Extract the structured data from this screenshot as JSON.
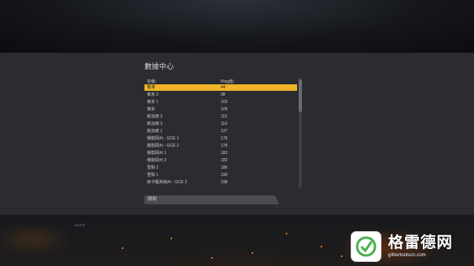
{
  "dialog": {
    "title": "數據中心",
    "columns": {
      "name": "名稱：",
      "ping": "Ping值："
    },
    "close_label": "關閉"
  },
  "servers": [
    {
      "name": "香港",
      "ping": "44",
      "selected": true
    },
    {
      "name": "東京 2",
      "ping": "98"
    },
    {
      "name": "東京 1",
      "ping": "103"
    },
    {
      "name": "東京",
      "ping": "109"
    },
    {
      "name": "新加坡 2",
      "ping": "115"
    },
    {
      "name": "新加坡 3",
      "ping": "116"
    },
    {
      "name": "新加坡 1",
      "ping": "127"
    },
    {
      "name": "俄勒岡州 - GCE 1",
      "ping": "178"
    },
    {
      "name": "俄勒岡州 - GCE 2",
      "ping": "178"
    },
    {
      "name": "俄勒岡州 1",
      "ping": "182"
    },
    {
      "name": "俄勒岡州 2",
      "ping": "182"
    },
    {
      "name": "雪梨 2",
      "ping": "186"
    },
    {
      "name": "雪梨 1",
      "ping": "190"
    },
    {
      "name": "南卡羅來納州 - GCE 2",
      "ping": "198"
    }
  ],
  "version": "v2.0.0",
  "watermark": {
    "text": "格雷德网",
    "url": "glittertoolscn.com"
  },
  "colors": {
    "selection": "#f0b428",
    "panel": "#2a2c30",
    "button": "#4a4c50"
  }
}
